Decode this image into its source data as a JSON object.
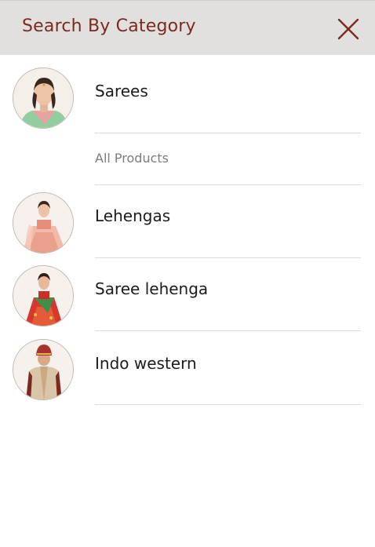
{
  "header": {
    "title": "Search By Category",
    "close_icon": "close-icon",
    "background": "#e2e0de",
    "title_color": "#7a2a22"
  },
  "categories": [
    {
      "label": "Sarees",
      "sub_items": [
        {
          "label": "All Products"
        }
      ],
      "icon": "saree-model-avatar"
    },
    {
      "label": "Lehengas",
      "icon": "lehenga-model-avatar"
    },
    {
      "label": "Saree lehenga",
      "icon": "saree-lehenga-model-avatar"
    },
    {
      "label": "Indo western",
      "icon": "indo-western-model-avatar"
    }
  ]
}
